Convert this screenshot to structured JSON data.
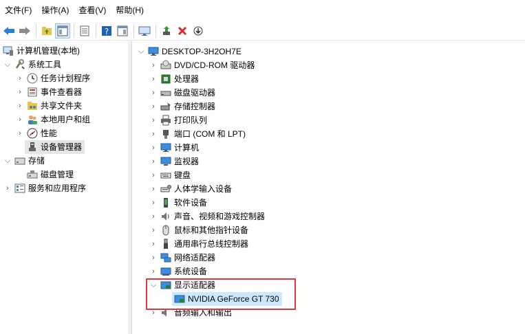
{
  "menu": [
    "文件(F)",
    "操作(A)",
    "查看(V)",
    "帮助(H)"
  ],
  "toolbar": {
    "buttons": [
      "back-icon",
      "forward-icon",
      "up-folder-icon",
      "show-tree-icon",
      "properties-icon",
      "help-icon",
      "show-action-pane-icon",
      "monitor-icon",
      "update-driver-icon",
      "uninstall-icon",
      "rollback-icon"
    ]
  },
  "tree": {
    "root": "计算机管理(本地)",
    "system_tools": "系统工具",
    "task_scheduler": "任务计划程序",
    "event_viewer": "事件查看器",
    "shared_folders": "共享文件夹",
    "local_users": "本地用户和组",
    "performance": "性能",
    "device_manager": "设备管理器",
    "storage": "存储",
    "disk_management": "磁盘管理",
    "services": "服务和应用程序"
  },
  "devices": {
    "computer_name": "DESKTOP-3H2OH7E",
    "categories": [
      "DVD/CD-ROM 驱动器",
      "处理器",
      "磁盘驱动器",
      "存储控制器",
      "打印队列",
      "端口 (COM 和 LPT)",
      "计算机",
      "监视器",
      "键盘",
      "人体学输入设备",
      "软件设备",
      "声音、视频和游戏控制器",
      "鼠标和其他指针设备",
      "通用串行总线控制器",
      "网络适配器",
      "系统设备",
      "显示适配器",
      "音频输入和输出"
    ],
    "display_adapter": "NVIDIA GeForce GT 730"
  },
  "colors": {
    "highlight_box": "#e0393e",
    "selection": "#cce8ff",
    "back_arrow": "#2b7fd6"
  }
}
